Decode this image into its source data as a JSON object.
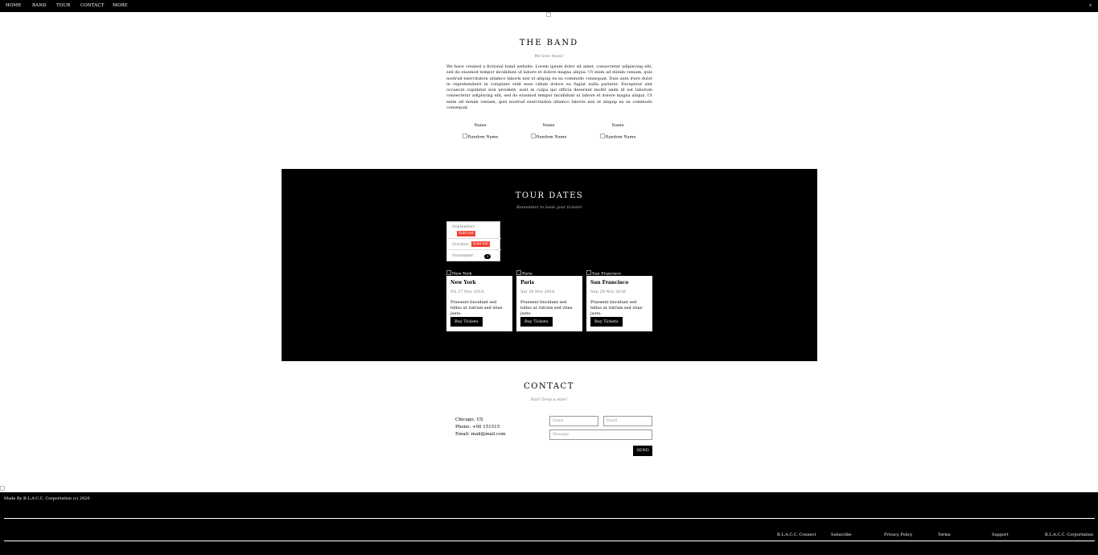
{
  "nav": {
    "home": "HOME",
    "band": "BAND",
    "tour": "TOUR",
    "contact": "CONTACT",
    "more": "MORE",
    "search_icon": "⌕"
  },
  "band": {
    "title": "THE BAND",
    "subtitle": "We love music",
    "text": "We have created a fictional band website. Lorem ipsum dolor sit amet, consectetur adipiscing elit, sed do eiusmod tempor incididunt ut labore et dolore magna aliqua. Ut enim ad minim veniam, quis nostrud exercitation ullamco laboris nisi ut aliquip ex ea commodo consequat. Duis aute irure dolor in reprehenderit in voluptate velit esse cillum dolore eu fugiat nulla pariatur. Excepteur sint occaecat cupidatat non proident, sunt in culpa qui officia deserunt mollit anim id est laborum consectetur adipiscing elit, sed do eiusmod tempor incididunt ut labore et dolore magna aliqua. Ut enim ad minim veniam, quis nostrud exercitation ullamco laboris nisi ut aliquip ex ea commodo consequat.",
    "members": [
      {
        "name": "Name",
        "image_alt": "Random Name"
      },
      {
        "name": "Name",
        "image_alt": "Random Name"
      },
      {
        "name": "Name",
        "image_alt": "Random Name"
      }
    ]
  },
  "tour": {
    "title": "TOUR DATES",
    "subtitle": "Remember to book your tickets!",
    "months": [
      {
        "label": "September",
        "badge": "Sold out"
      },
      {
        "label": "October",
        "badge": "Sold out"
      },
      {
        "label": "November",
        "count": "3"
      }
    ],
    "cards": [
      {
        "image_alt": "New York",
        "city": "New York",
        "date": "Fri 27 Nov 2016",
        "desc": "Praesent tincidunt sed tellus ut rutrum sed vitae justo.",
        "button": "Buy Tickets"
      },
      {
        "image_alt": "Paris",
        "city": "Paris",
        "date": "Sat 28 Nov 2016",
        "desc": "Praesent tincidunt sed tellus ut rutrum sed vitae justo.",
        "button": "Buy Tickets"
      },
      {
        "image_alt": "San Francisco",
        "city": "San Francisco",
        "date": "Sun 29 Nov 2016",
        "desc": "Praesent tincidunt sed tellus ut rutrum sed vitae justo.",
        "button": "Buy Tickets"
      }
    ]
  },
  "contact": {
    "title": "CONTACT",
    "subtitle": "Fan? Drop a note!",
    "location": "Chicago, US",
    "phone": "Phone: +00 151515",
    "email": "Email: mail@mail.com",
    "name_placeholder": "Name",
    "email_placeholder": "Email",
    "message_placeholder": "Message",
    "send": "SEND"
  },
  "footer": {
    "made_by": "Made By B.L.A.C.C. Corportation (c) 2020",
    "links": [
      "B.L.A.C.C. Connect",
      "Subscribe",
      "Privacy Policy",
      "Terms",
      "Support",
      "B.L.A.C.C. Corportation"
    ]
  }
}
